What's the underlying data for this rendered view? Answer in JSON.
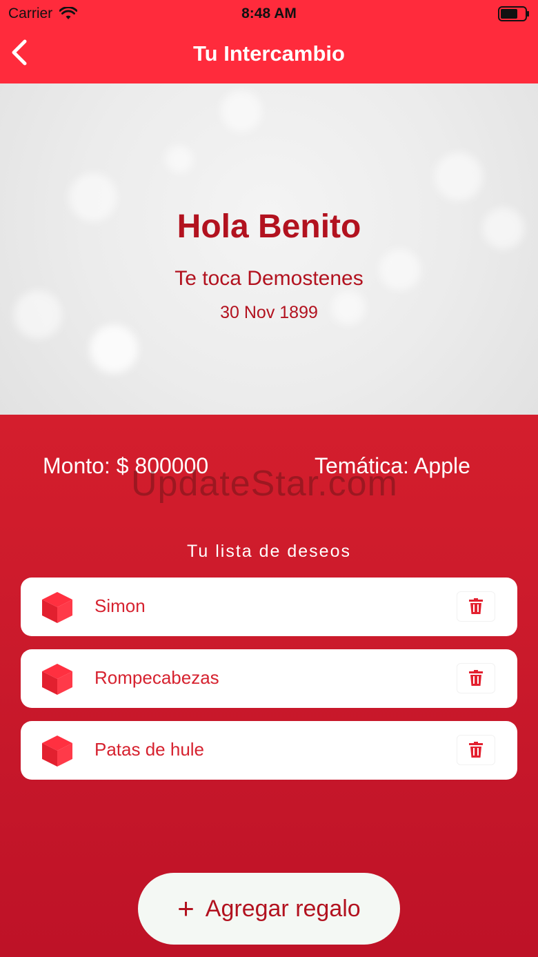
{
  "status": {
    "carrier": "Carrier",
    "time": "8:48 AM"
  },
  "nav": {
    "title": "Tu Intercambio"
  },
  "hero": {
    "greeting": "Hola Benito",
    "subtitle": "Te toca Demostenes",
    "date": "30 Nov 1899"
  },
  "info": {
    "monto": "Monto: $ 800000",
    "tematica": "Temática: Apple"
  },
  "watermark": "UpdateStar.com",
  "wishlist": {
    "title": "Tu lista de deseos",
    "items": [
      {
        "label": "Simon"
      },
      {
        "label": "Rompecabezas"
      },
      {
        "label": "Patas de hule"
      }
    ]
  },
  "add_button": {
    "label": "Agregar regalo"
  },
  "colors": {
    "accent": "#ff2b3c",
    "brand_dark": "#b2121f",
    "item_text": "#d6222f"
  }
}
